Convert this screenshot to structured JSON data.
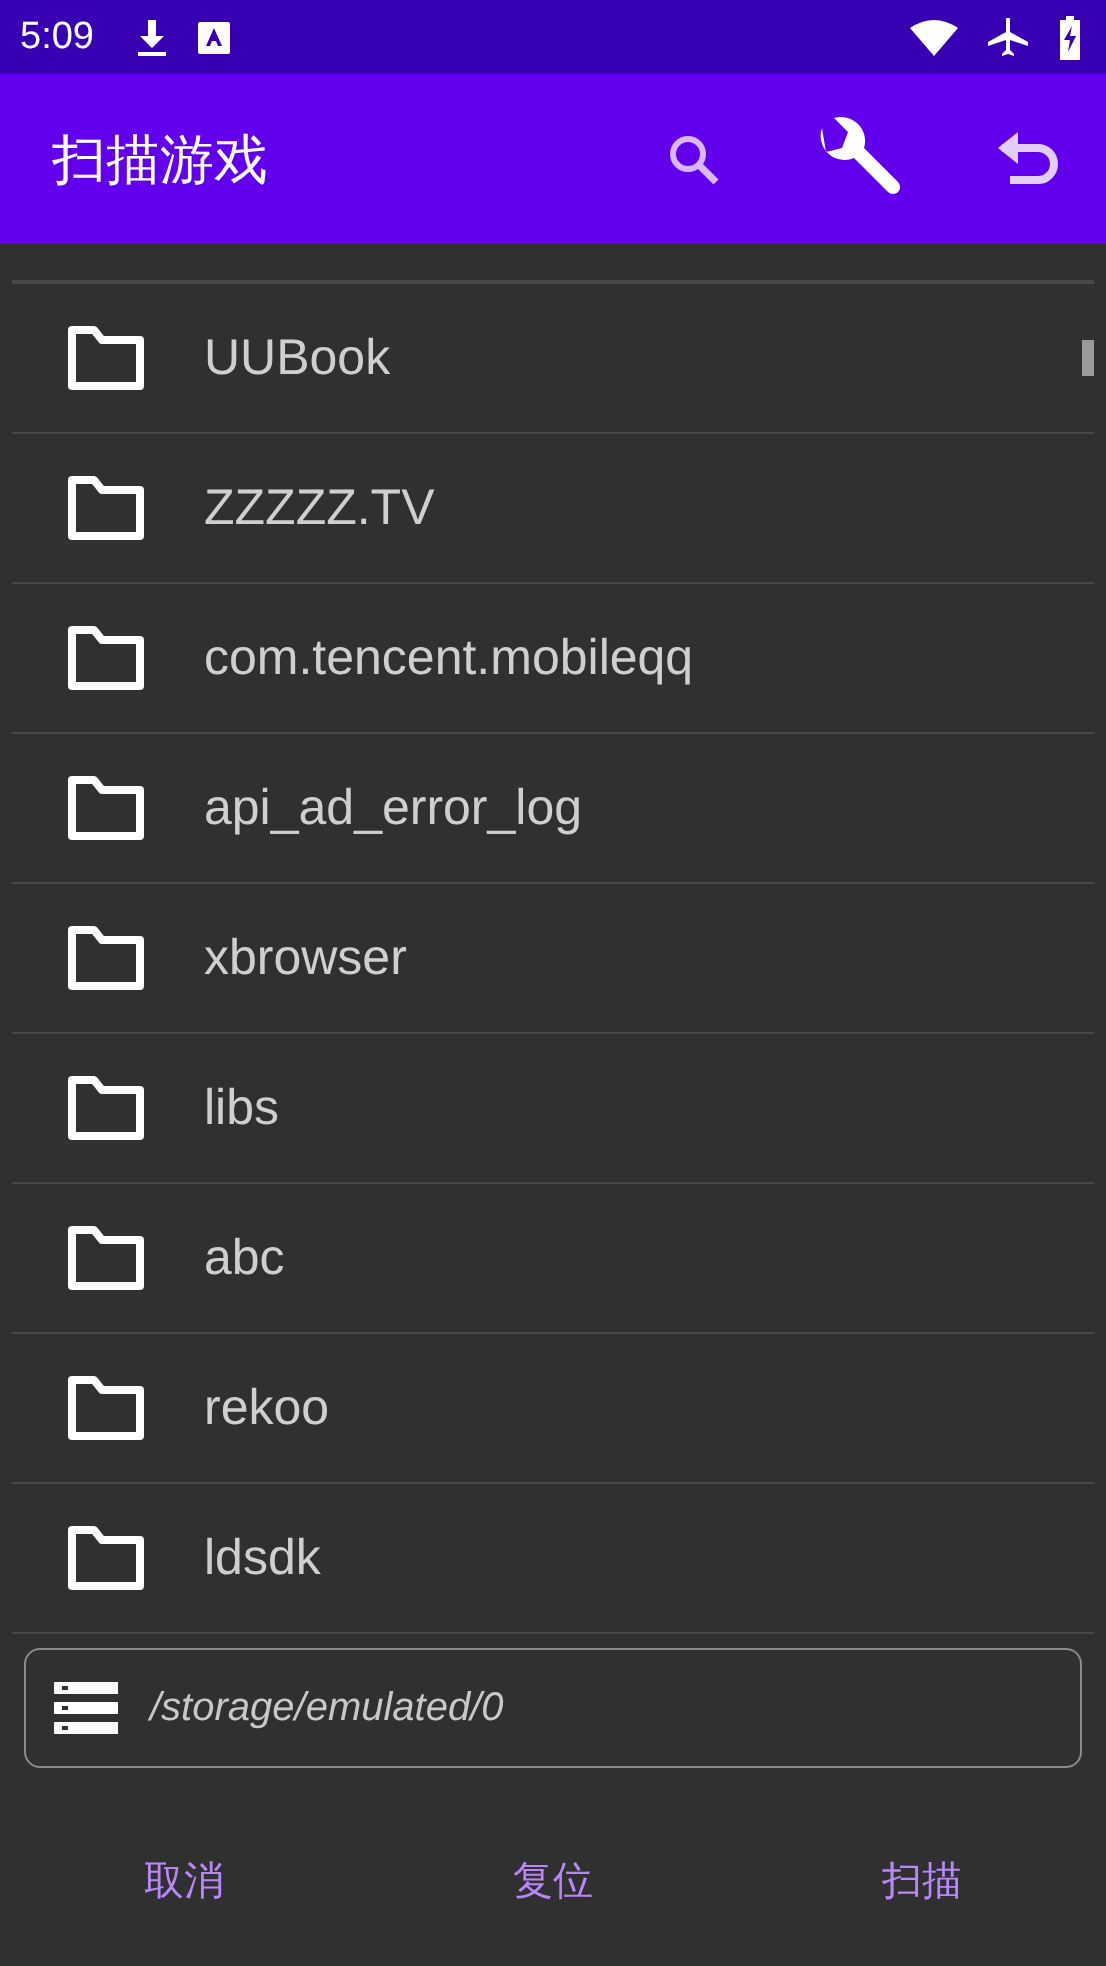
{
  "status_bar": {
    "time": "5:09"
  },
  "app_bar": {
    "title": "扫描游戏"
  },
  "folders": [
    {
      "name": "UUBook"
    },
    {
      "name": "ZZZZZ.TV"
    },
    {
      "name": "com.tencent.mobileqq"
    },
    {
      "name": "api_ad_error_log"
    },
    {
      "name": "xbrowser"
    },
    {
      "name": "libs"
    },
    {
      "name": "abc"
    },
    {
      "name": "rekoo"
    },
    {
      "name": "ldsdk"
    }
  ],
  "path_field": {
    "value": "/storage/emulated/0"
  },
  "buttons": [
    "取消",
    "复位",
    "扫描"
  ]
}
